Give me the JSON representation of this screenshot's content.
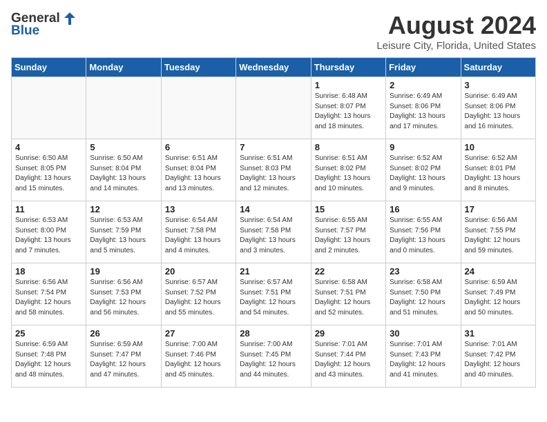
{
  "logo": {
    "general": "General",
    "blue": "Blue"
  },
  "header": {
    "title": "August 2024",
    "subtitle": "Leisure City, Florida, United States"
  },
  "days_of_week": [
    "Sunday",
    "Monday",
    "Tuesday",
    "Wednesday",
    "Thursday",
    "Friday",
    "Saturday"
  ],
  "weeks": [
    [
      {
        "day": "",
        "info": ""
      },
      {
        "day": "",
        "info": ""
      },
      {
        "day": "",
        "info": ""
      },
      {
        "day": "",
        "info": ""
      },
      {
        "day": "1",
        "info": "Sunrise: 6:48 AM\nSunset: 8:07 PM\nDaylight: 13 hours\nand 18 minutes."
      },
      {
        "day": "2",
        "info": "Sunrise: 6:49 AM\nSunset: 8:06 PM\nDaylight: 13 hours\nand 17 minutes."
      },
      {
        "day": "3",
        "info": "Sunrise: 6:49 AM\nSunset: 8:06 PM\nDaylight: 13 hours\nand 16 minutes."
      }
    ],
    [
      {
        "day": "4",
        "info": "Sunrise: 6:50 AM\nSunset: 8:05 PM\nDaylight: 13 hours\nand 15 minutes."
      },
      {
        "day": "5",
        "info": "Sunrise: 6:50 AM\nSunset: 8:04 PM\nDaylight: 13 hours\nand 14 minutes."
      },
      {
        "day": "6",
        "info": "Sunrise: 6:51 AM\nSunset: 8:04 PM\nDaylight: 13 hours\nand 13 minutes."
      },
      {
        "day": "7",
        "info": "Sunrise: 6:51 AM\nSunset: 8:03 PM\nDaylight: 13 hours\nand 12 minutes."
      },
      {
        "day": "8",
        "info": "Sunrise: 6:51 AM\nSunset: 8:02 PM\nDaylight: 13 hours\nand 10 minutes."
      },
      {
        "day": "9",
        "info": "Sunrise: 6:52 AM\nSunset: 8:02 PM\nDaylight: 13 hours\nand 9 minutes."
      },
      {
        "day": "10",
        "info": "Sunrise: 6:52 AM\nSunset: 8:01 PM\nDaylight: 13 hours\nand 8 minutes."
      }
    ],
    [
      {
        "day": "11",
        "info": "Sunrise: 6:53 AM\nSunset: 8:00 PM\nDaylight: 13 hours\nand 7 minutes."
      },
      {
        "day": "12",
        "info": "Sunrise: 6:53 AM\nSunset: 7:59 PM\nDaylight: 13 hours\nand 5 minutes."
      },
      {
        "day": "13",
        "info": "Sunrise: 6:54 AM\nSunset: 7:58 PM\nDaylight: 13 hours\nand 4 minutes."
      },
      {
        "day": "14",
        "info": "Sunrise: 6:54 AM\nSunset: 7:58 PM\nDaylight: 13 hours\nand 3 minutes."
      },
      {
        "day": "15",
        "info": "Sunrise: 6:55 AM\nSunset: 7:57 PM\nDaylight: 13 hours\nand 2 minutes."
      },
      {
        "day": "16",
        "info": "Sunrise: 6:55 AM\nSunset: 7:56 PM\nDaylight: 13 hours\nand 0 minutes."
      },
      {
        "day": "17",
        "info": "Sunrise: 6:56 AM\nSunset: 7:55 PM\nDaylight: 12 hours\nand 59 minutes."
      }
    ],
    [
      {
        "day": "18",
        "info": "Sunrise: 6:56 AM\nSunset: 7:54 PM\nDaylight: 12 hours\nand 58 minutes."
      },
      {
        "day": "19",
        "info": "Sunrise: 6:56 AM\nSunset: 7:53 PM\nDaylight: 12 hours\nand 56 minutes."
      },
      {
        "day": "20",
        "info": "Sunrise: 6:57 AM\nSunset: 7:52 PM\nDaylight: 12 hours\nand 55 minutes."
      },
      {
        "day": "21",
        "info": "Sunrise: 6:57 AM\nSunset: 7:51 PM\nDaylight: 12 hours\nand 54 minutes."
      },
      {
        "day": "22",
        "info": "Sunrise: 6:58 AM\nSunset: 7:51 PM\nDaylight: 12 hours\nand 52 minutes."
      },
      {
        "day": "23",
        "info": "Sunrise: 6:58 AM\nSunset: 7:50 PM\nDaylight: 12 hours\nand 51 minutes."
      },
      {
        "day": "24",
        "info": "Sunrise: 6:59 AM\nSunset: 7:49 PM\nDaylight: 12 hours\nand 50 minutes."
      }
    ],
    [
      {
        "day": "25",
        "info": "Sunrise: 6:59 AM\nSunset: 7:48 PM\nDaylight: 12 hours\nand 48 minutes."
      },
      {
        "day": "26",
        "info": "Sunrise: 6:59 AM\nSunset: 7:47 PM\nDaylight: 12 hours\nand 47 minutes."
      },
      {
        "day": "27",
        "info": "Sunrise: 7:00 AM\nSunset: 7:46 PM\nDaylight: 12 hours\nand 45 minutes."
      },
      {
        "day": "28",
        "info": "Sunrise: 7:00 AM\nSunset: 7:45 PM\nDaylight: 12 hours\nand 44 minutes."
      },
      {
        "day": "29",
        "info": "Sunrise: 7:01 AM\nSunset: 7:44 PM\nDaylight: 12 hours\nand 43 minutes."
      },
      {
        "day": "30",
        "info": "Sunrise: 7:01 AM\nSunset: 7:43 PM\nDaylight: 12 hours\nand 41 minutes."
      },
      {
        "day": "31",
        "info": "Sunrise: 7:01 AM\nSunset: 7:42 PM\nDaylight: 12 hours\nand 40 minutes."
      }
    ]
  ]
}
